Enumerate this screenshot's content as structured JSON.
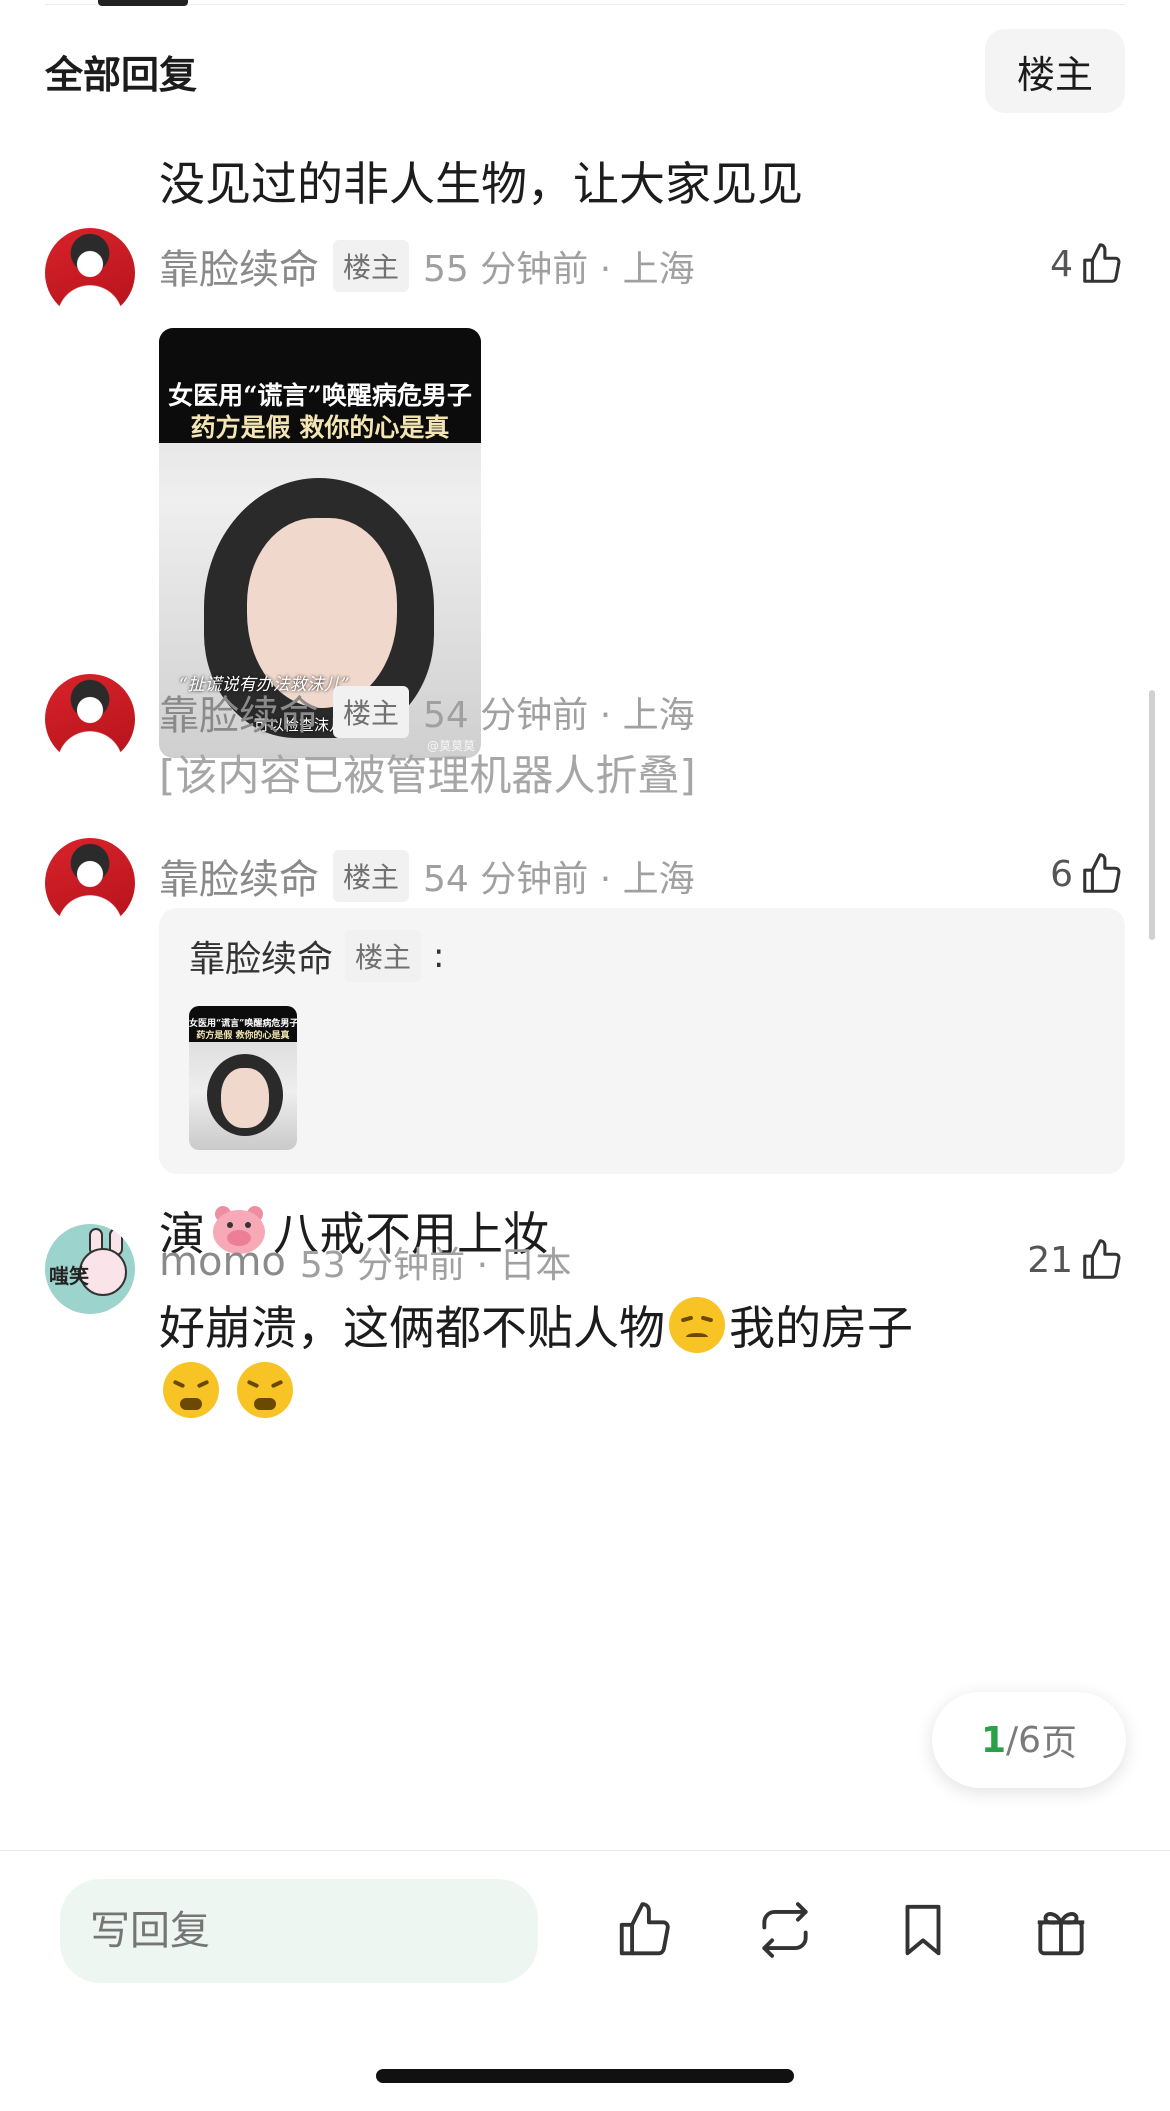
{
  "header": {
    "title": "全部回复",
    "owner_filter": "楼主"
  },
  "op_text": "没见过的非人生物，让大家见见",
  "comments": [
    {
      "username": "靠脸续命",
      "badge": "楼主",
      "time_location": "55 分钟前 · 上海",
      "likes": "4",
      "image": {
        "caption_line1": "女医用“谎言”唤醒病危男子",
        "caption_line2": "药方是假 救你的心是真",
        "subtitle": "“扯谎说有办法救沫儿”",
        "subtitle2": "可以检查沫儿的病",
        "watermark": "@莫莫莫"
      }
    },
    {
      "username": "靠脸续命",
      "badge": "楼主",
      "time_location": "54 分钟前 · 上海",
      "text": "[该内容已被管理机器人折叠]"
    },
    {
      "username": "靠脸续命",
      "badge": "楼主",
      "time_location": "54 分钟前 · 上海",
      "likes": "6",
      "quote": {
        "username": "靠脸续命",
        "badge": "楼主",
        "colon": ":",
        "thumb_line1": "女医用“谎言”唤醒病危男子",
        "thumb_line2": "药方是假 救你的心是真"
      },
      "text_before": "演",
      "emoji": "pig-face",
      "text_after": "八戒不用上妆"
    },
    {
      "username": "momo",
      "avatar_text": "嗤笑",
      "time_location": "53 分钟前 · 日本",
      "likes": "21",
      "text_before": "好崩溃，这俩都不贴人物",
      "emoji_mid": "disappointed-face",
      "text_after": "我的房子",
      "emoji_row": [
        "tired-face",
        "tired-face"
      ]
    }
  ],
  "pagination": {
    "current": "1",
    "separator": "/",
    "total": "6",
    "suffix": " 页"
  },
  "bottom_bar": {
    "reply_placeholder": "写回复",
    "icons": [
      "thumbs-up-icon",
      "repost-icon",
      "bookmark-icon",
      "gift-icon"
    ]
  },
  "colors": {
    "accent_green": "#2aa146",
    "meta_gray": "#a0a0a0",
    "input_bg": "#eef6f2"
  }
}
